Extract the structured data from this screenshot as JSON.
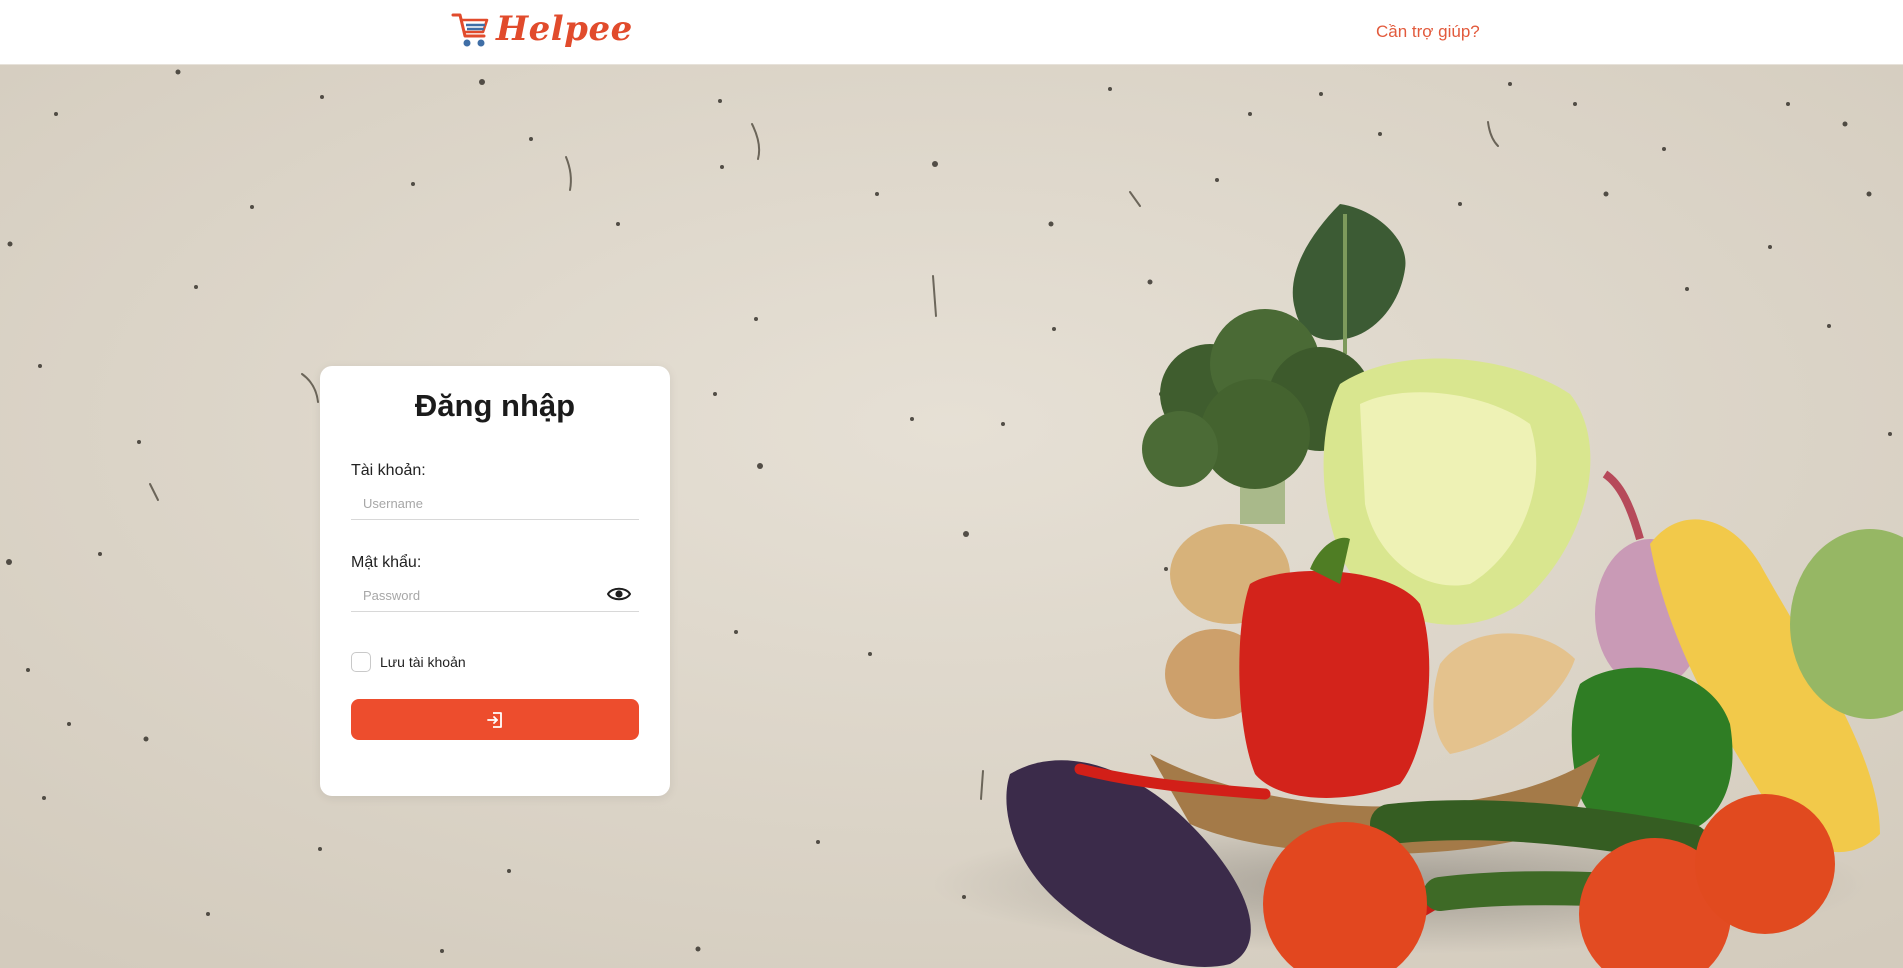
{
  "header": {
    "logo_text": "Helpee",
    "logo_icon": "shopping-cart-icon",
    "help_link": "Cần trợ giúp?"
  },
  "login": {
    "title": "Đăng nhập",
    "username_label": "Tài khoản:",
    "username_placeholder": "Username",
    "username_value": "",
    "password_label": "Mật khẩu:",
    "password_placeholder": "Password",
    "password_value": "",
    "password_toggle_icon": "eye-icon",
    "remember_label": "Lưu tài khoản",
    "remember_checked": false,
    "submit_icon": "sign-in-icon"
  },
  "colors": {
    "brand": "#e14b2c",
    "button": "#ed4d2d",
    "background": "#dcd5c9"
  }
}
